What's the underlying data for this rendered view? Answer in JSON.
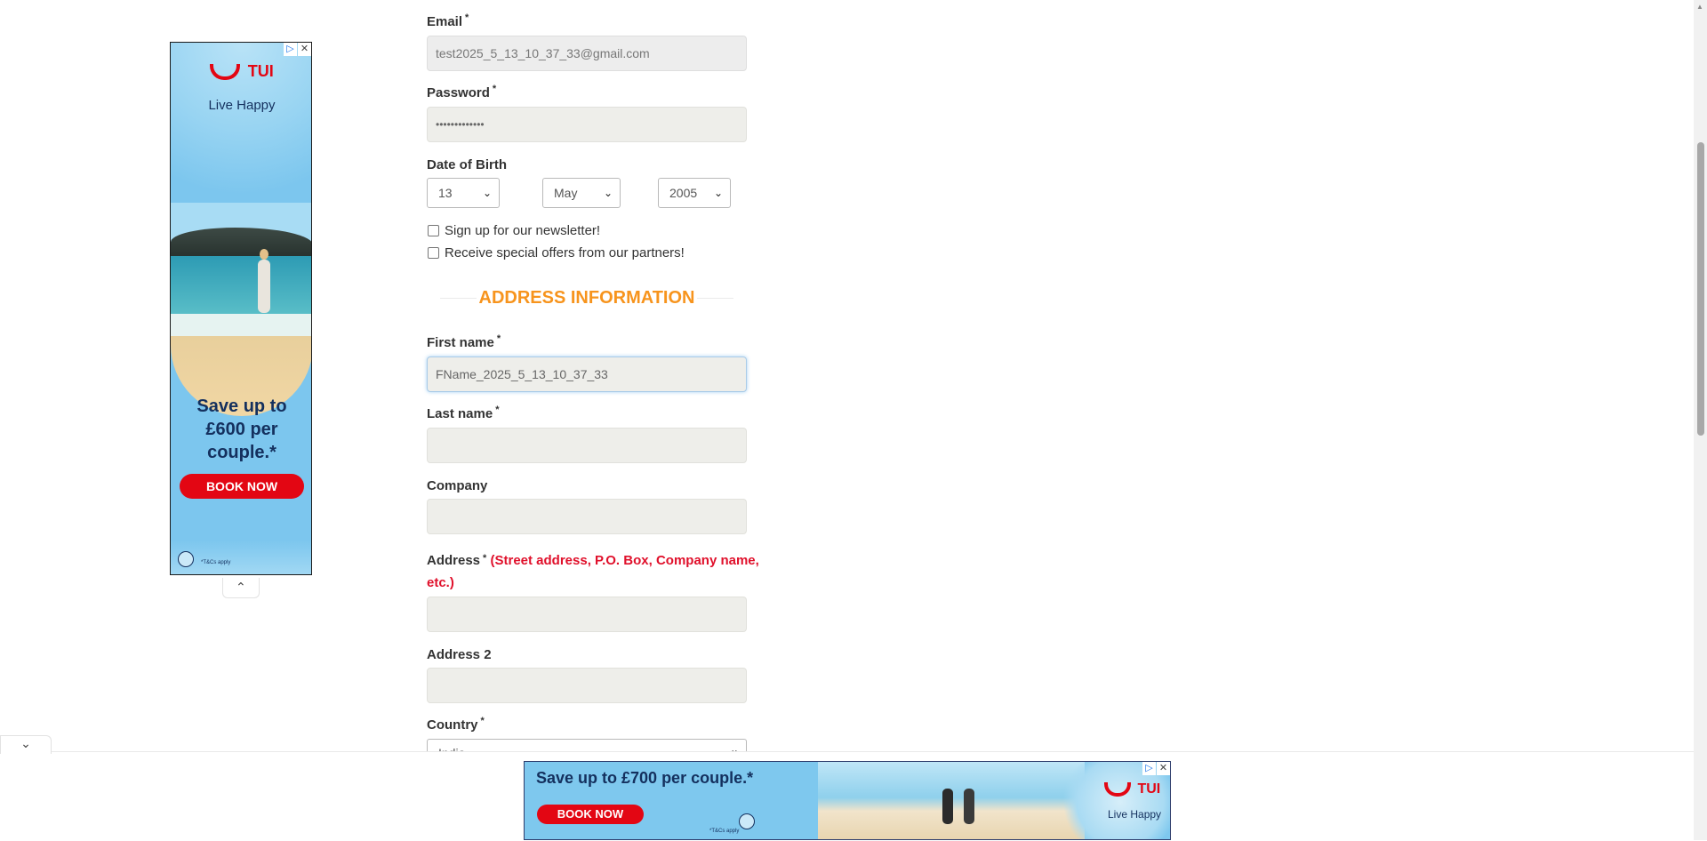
{
  "form": {
    "email_label": "Email",
    "email_value": "test2025_5_13_10_37_33@gmail.com",
    "password_label": "Password",
    "password_value": "•••••••••••••",
    "dob_label": "Date of Birth",
    "dob_day": "13",
    "dob_month": "May",
    "dob_year": "2005",
    "newsletter_label": "Sign up for our newsletter!",
    "offers_label": "Receive special offers from our partners!",
    "address_section_title": "ADDRESS INFORMATION",
    "firstname_label": "First name",
    "firstname_value": "FName_2025_5_13_10_37_33",
    "lastname_label": "Last name",
    "company_label": "Company",
    "address_label": "Address",
    "address_hint_line1": "(Street address, P.O. Box, Company name,",
    "address_hint_line2": "etc.)",
    "address2_label": "Address 2",
    "country_label": "Country",
    "country_value": "India",
    "required_marker": "*"
  },
  "ads": {
    "side": {
      "brand": "TUI",
      "tagline": "Live Happy",
      "headline_line1": "Save up to",
      "headline_line2": "£600 per",
      "headline_line3": "couple.*",
      "cta": "BOOK NOW",
      "terms": "*T&Cs apply"
    },
    "bottom": {
      "headline": "Save up to £700 per couple.*",
      "cta": "BOOK NOW",
      "terms": "*T&Cs apply",
      "brand": "TUI",
      "tagline": "Live Happy"
    }
  },
  "colors": {
    "accent": "#f7941d",
    "hint_red": "#e0102b",
    "tui_red": "#e30613",
    "ad_blue": "#7cc6ee",
    "ad_navy": "#14305e"
  }
}
